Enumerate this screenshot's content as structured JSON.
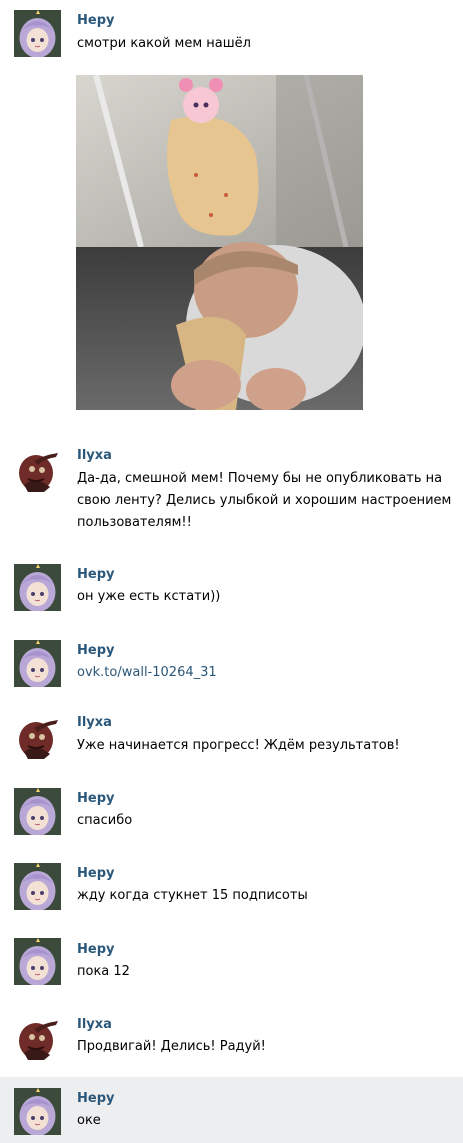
{
  "users": {
    "hepy": "Hepy",
    "ilyxa": "Ilyxa"
  },
  "colors": {
    "author": "#2b587a",
    "link": "#2b587a",
    "highlight_bg": "#edeef0"
  },
  "messages": [
    {
      "author": "Hepy",
      "text": "смотри какой мем нашёл",
      "has_image": true,
      "avatar": "anime-girl-avatar"
    },
    {
      "author": "Ilyxa",
      "text": "Да-да, смешной мем! Почему бы не опубликовать на свою ленту? Делись улыбкой и хорошим настроением пользователям!!",
      "avatar": "creature-avatar"
    },
    {
      "author": "Hepy",
      "text": "он уже есть кстати))",
      "avatar": "anime-girl-avatar"
    },
    {
      "author": "Hepy",
      "link": "ovk.to/wall-10264_31",
      "avatar": "anime-girl-avatar"
    },
    {
      "author": "Ilyxa",
      "text": "Уже начинается прогресс! Ждём результатов!",
      "avatar": "creature-avatar"
    },
    {
      "author": "Hepy",
      "text": "спасибо",
      "avatar": "anime-girl-avatar"
    },
    {
      "author": "Hepy",
      "text": "жду когда стукнет 15 подписоты",
      "avatar": "anime-girl-avatar"
    },
    {
      "author": "Hepy",
      "text": "пока 12",
      "avatar": "anime-girl-avatar"
    },
    {
      "author": "Ilyxa",
      "text": "Продвигай! Делись! Радуй!",
      "avatar": "creature-avatar"
    },
    {
      "author": "Hepy",
      "text": "оке",
      "avatar": "anime-girl-avatar",
      "highlighted": true
    }
  ]
}
